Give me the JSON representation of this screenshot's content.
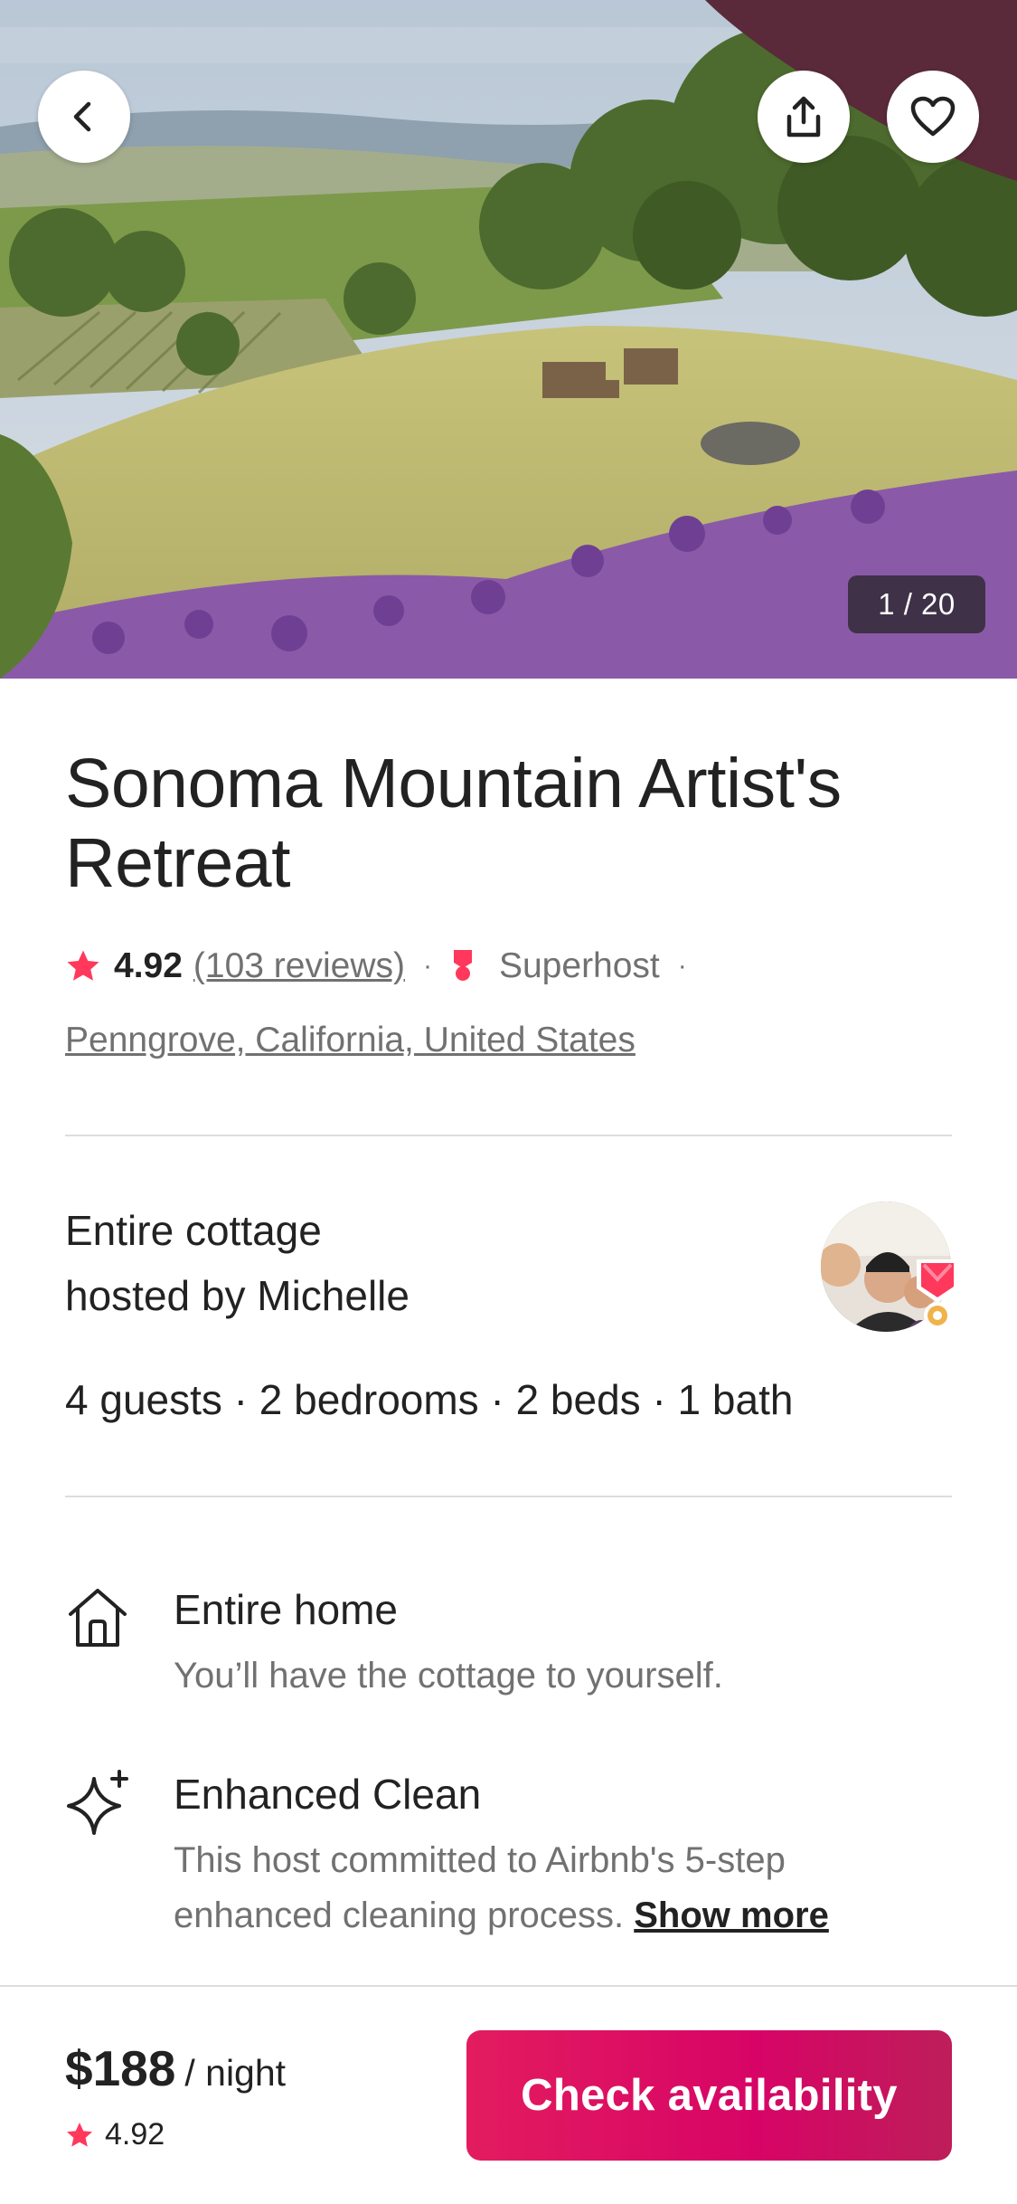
{
  "hero": {
    "photo_counter": "1 / 20",
    "buttons": {
      "back": "chevron-left-icon",
      "share": "share-icon",
      "save": "heart-icon"
    }
  },
  "listing": {
    "title": "Sonoma Mountain Artist's Retreat",
    "rating": "4.92",
    "reviews": "(103 reviews)",
    "separator": "·",
    "superhost": "Superhost",
    "location": "Penngrove, California, United States"
  },
  "host": {
    "title_line1": "Entire cottage",
    "title_line2": "hosted by Michelle",
    "stats": "4 guests · 2 bedrooms · 2 beds · 1 bath"
  },
  "highlights": [
    {
      "icon": "home-icon",
      "title": "Entire home",
      "description": "You’ll have the cottage to yourself."
    },
    {
      "icon": "sparkle-icon",
      "title": "Enhanced Clean",
      "description": "This host committed to Airbnb's 5-step enhanced cleaning process.",
      "link": "Show more"
    }
  ],
  "footer": {
    "price": "$188",
    "unit": "/ night",
    "rating": "4.92",
    "cta": "Check availability"
  },
  "colors": {
    "brand": "#FF385C",
    "cta_gradient": [
      "#E31C5F",
      "#D70466",
      "#BD1E59"
    ],
    "text_primary": "#222222",
    "text_secondary": "#717171",
    "divider": "#DDDDDD"
  }
}
